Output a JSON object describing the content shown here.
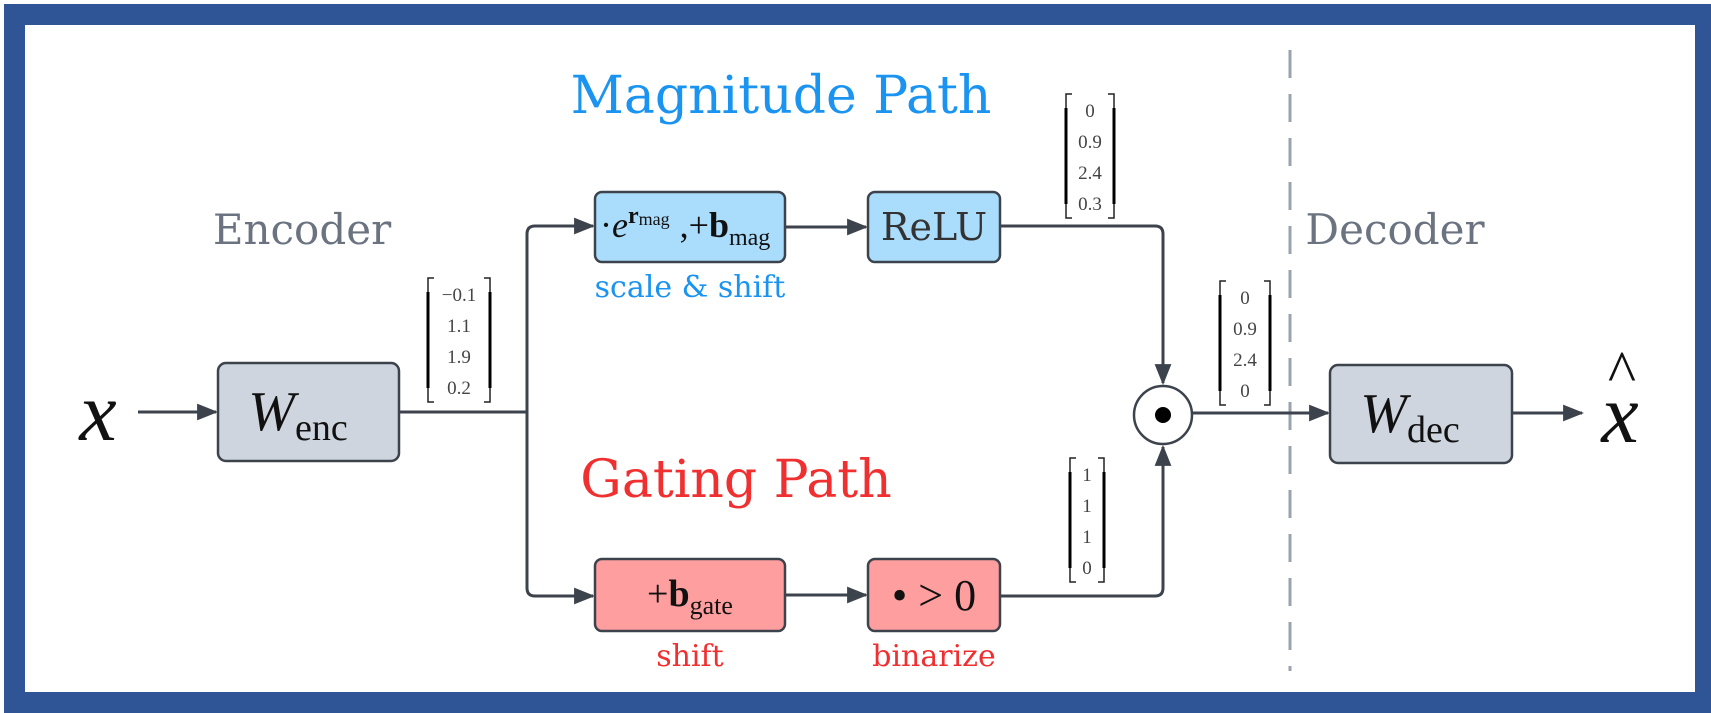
{
  "diagram": {
    "title_magnitude": "Magnitude Path",
    "title_gating": "Gating Path",
    "encoder_label": "Encoder",
    "decoder_label": "Decoder",
    "input_symbol": "x",
    "output_symbol": "x",
    "output_hat": "^",
    "encoder_box": {
      "main": "W",
      "sub": "enc"
    },
    "decoder_box": {
      "main": "W",
      "sub": "dec"
    },
    "mag_scale_box": {
      "dot": "·",
      "e": "e",
      "exp_main": "r",
      "exp_sub": "mag",
      "plus": ",+",
      "b": "b",
      "b_sub": "mag",
      "caption": "scale & shift"
    },
    "relu_box": {
      "label": "ReLU"
    },
    "gate_shift_box": {
      "plus": "+",
      "b": "b",
      "b_sub": "gate",
      "caption": "shift"
    },
    "binarize_box": {
      "label": "• > 0",
      "caption": "binarize"
    },
    "hadamard_symbol": "⊙",
    "vectors": {
      "pre_activation": [
        "−0.1",
        "1.1",
        "1.9",
        "0.2"
      ],
      "magnitude_out": [
        "0",
        "0.9",
        "2.4",
        "0.3"
      ],
      "gate_out": [
        "1",
        "1",
        "1",
        "0"
      ],
      "features": [
        "0",
        "0.9",
        "2.4",
        "0"
      ]
    },
    "colors": {
      "frame": "#2f5597",
      "magnitude": "#1a94f0",
      "gating": "#f03030",
      "section_label": "#6b7380",
      "mag_box_fill": "#aadcfc",
      "gate_box_fill": "#ff9e9e",
      "weight_box_fill": "#cfd5de",
      "line": "#3d434c",
      "divider": "#9aa3ad"
    }
  }
}
